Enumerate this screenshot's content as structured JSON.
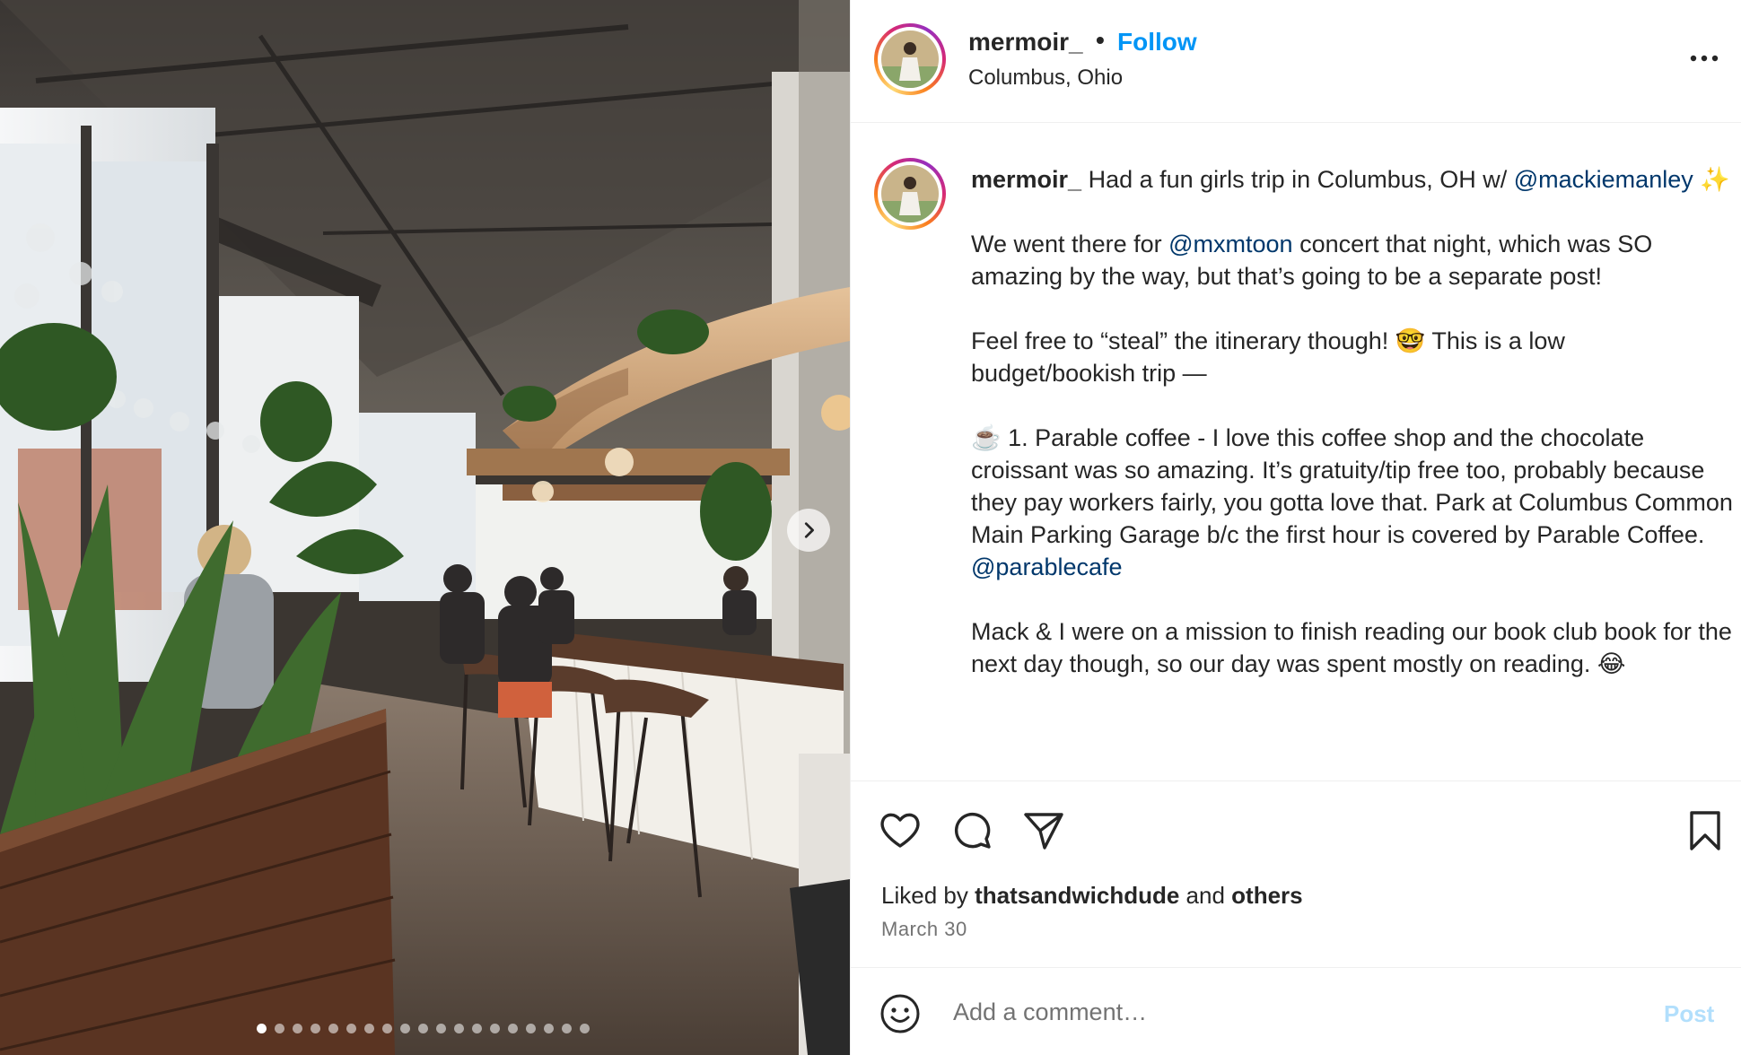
{
  "post": {
    "username": "mermoir_",
    "separator": "•",
    "follow_label": "Follow",
    "location": "Columbus, Ohio",
    "more_icon": "more-horizontal-icon"
  },
  "media": {
    "image_count": 19,
    "active_index": 0,
    "next_icon": "chevron-right-icon"
  },
  "caption": {
    "username": "mermoir_",
    "p1_text": " Had a fun girls trip in Columbus, OH w/ ",
    "p1_mention": "@mackiemanley",
    "p1_emoji": " ✨",
    "p2_before": "We went there for ",
    "p2_mention": "@mxmtoon",
    "p2_after": " concert that night, which was SO amazing by the way, but that’s going to be a separate post!",
    "p3": "Feel free to “steal” the itinerary though! 🤓 This is a low budget/bookish trip —",
    "p4_text": "☕️ 1. Parable coffee - I love this coffee shop and the chocolate croissant was so amazing. It’s gratuity/tip free too, probably because they pay workers fairly, you gotta love that. Park at Columbus Common Main Parking Garage b/c the first hour is covered by Parable Coffee. ",
    "p4_mention": "@parablecafe",
    "p5": "Mack & I were on a mission to finish reading our book club book for the next day though, so our day was spent mostly on reading. 😂"
  },
  "actions": {
    "like_icon": "heart-icon",
    "comment_icon": "comment-icon",
    "share_icon": "paper-plane-icon",
    "save_icon": "bookmark-icon"
  },
  "likes": {
    "prefix": "Liked by ",
    "user": "thatsandwichdude",
    "middle": " and ",
    "others": "others"
  },
  "date": "March 30",
  "comment": {
    "placeholder": "Add a comment…",
    "post_label": "Post",
    "emoji_icon": "smiley-icon"
  },
  "colors": {
    "follow": "#0095f6",
    "mention": "#00376b",
    "post_disabled": "#b2dffc",
    "secondary_text": "#737373"
  }
}
